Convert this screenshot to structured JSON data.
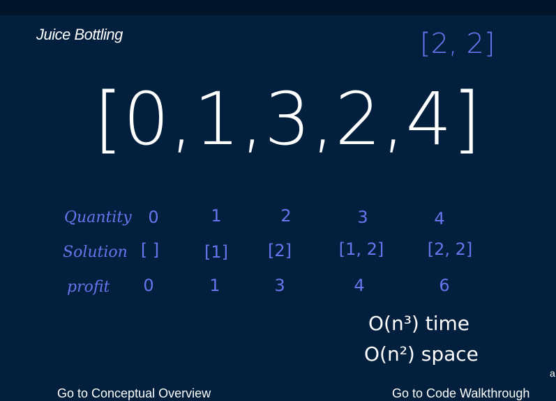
{
  "title": "Juice Bottling",
  "top_right_note": "[2, 2]",
  "big_array": "[0,1,3,2,4]",
  "table": {
    "labels": [
      "Quantity",
      "Solution",
      "profit"
    ],
    "quantity": [
      "0",
      "1",
      "2",
      "3",
      "4"
    ],
    "solution": [
      "[ ]",
      "[1]",
      "[2]",
      "[1, 2]",
      "[2, 2]"
    ],
    "profit": [
      "0",
      "1",
      "3",
      "4",
      "6"
    ]
  },
  "complexity": {
    "time": "O(n³) time",
    "space": "O(n²) space"
  },
  "corner_text": "a",
  "links": {
    "conceptual": "Go to Conceptual Overview",
    "code": "Go to Code Walkthrough"
  },
  "colors": {
    "background": "#02203d",
    "ink": "#6676ee",
    "topbar": "#00152a"
  }
}
